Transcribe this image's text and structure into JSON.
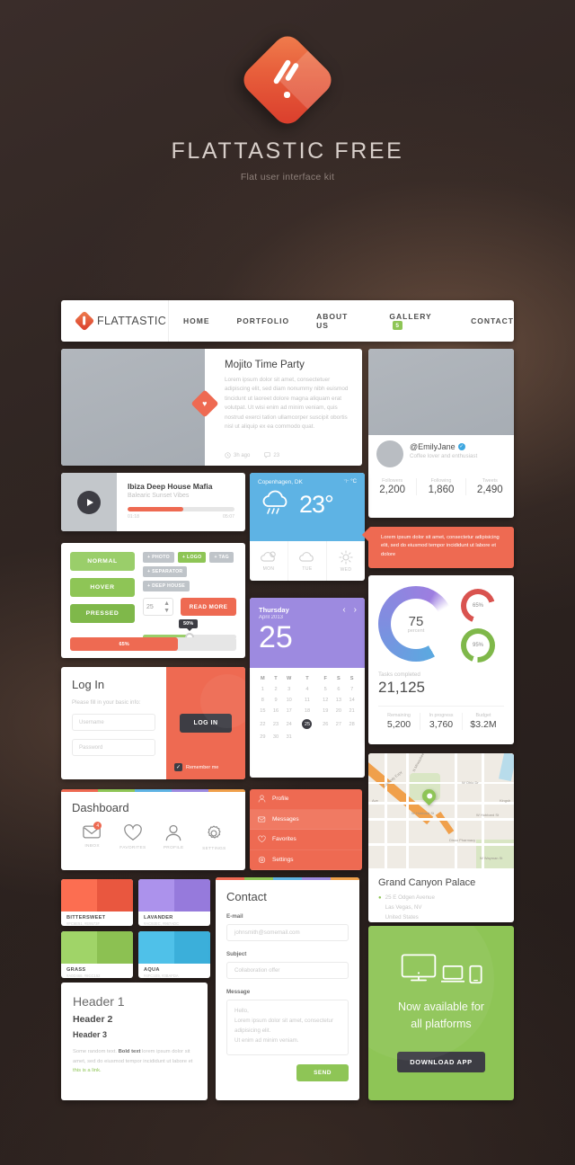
{
  "hero": {
    "title": "FLATTASTIC FREE",
    "subtitle": "Flat user interface kit",
    "logo_icon": "flattastic-diamond-logo"
  },
  "nav": {
    "brand": "FLATTASTIC",
    "links": [
      {
        "label": "HOME",
        "badge": null
      },
      {
        "label": "PORTFOLIO",
        "badge": null
      },
      {
        "label": "ABOUT US",
        "badge": null
      },
      {
        "label": "GALLERY",
        "badge": "5"
      },
      {
        "label": "CONTACT",
        "badge": null
      }
    ]
  },
  "article": {
    "title": "Mojito Time Party",
    "body": "Lorem ipsum dolor sit amet, consectetuer adipiscing elit, sed diam nonummy nibh euismod tincidunt ut laoreet dolore magna aliquam erat volutpat. Ut wisi enim ad minim veniam, quis nostrud exerci tation ullamcorper suscipit obortis nisl ut aliquip ex ea commodo quat.",
    "time": "3h ago",
    "comments": "23",
    "favorite_icon": "heart-icon",
    "clock_icon": "clock-icon",
    "comment_icon": "comment-bubble-icon"
  },
  "twitter": {
    "handle": "@EmilyJane",
    "verified_icon": "verified-check-icon",
    "bio": "Coffee lover and enthusiast",
    "stats": [
      {
        "label": "Followers",
        "value": "2,200"
      },
      {
        "label": "Following",
        "value": "1,860"
      },
      {
        "label": "Tweets",
        "value": "2,490"
      }
    ]
  },
  "music": {
    "title": "Ibiza Deep House Mafia",
    "subtitle": "Balearic Sunset Vibes",
    "elapsed": "01:18",
    "total": "05:07",
    "play_icon": "play-icon",
    "progress_percent": 52
  },
  "weather": {
    "city": "Copenhagen, DK",
    "unit_f": "°F",
    "unit_c": "°C",
    "temperature": "23°",
    "current_icon": "rain-cloud-icon",
    "forecast": [
      {
        "day": "MON",
        "icon": "partly-cloudy-icon"
      },
      {
        "day": "TUE",
        "icon": "cloud-icon"
      },
      {
        "day": "WED",
        "icon": "sun-icon"
      }
    ]
  },
  "alert": {
    "text": "Lorem ipsum dolor sit amet, consectetur adipisicing elit, sed do eiusmod tempor incididunt ut labore et dolore",
    "color": "#ee6a52"
  },
  "buttons_panel": {
    "states": [
      "NORMAL",
      "HOVER",
      "PRESSED"
    ],
    "tags": [
      {
        "label": "+ PHOTO",
        "active": false
      },
      {
        "label": "+ LOGO",
        "active": true
      },
      {
        "label": "+ TAG",
        "active": false
      },
      {
        "label": "+ SEPARATOR",
        "active": false
      },
      {
        "label": "+ DEEP HOUSE",
        "active": false
      }
    ],
    "spinner_value": "25",
    "read_more_label": "READ MORE",
    "slider_tooltip": "50%",
    "progress_label": "65%"
  },
  "calendar": {
    "weekday": "Thursday",
    "month_year": "April 2013",
    "day_number": "25",
    "prev_icon": "chevron-left-icon",
    "next_icon": "chevron-right-icon",
    "day_headers": [
      "M",
      "T",
      "W",
      "T",
      "F",
      "S",
      "S"
    ],
    "weeks": [
      [
        "1",
        "2",
        "3",
        "4",
        "5",
        "6",
        "7"
      ],
      [
        "8",
        "9",
        "10",
        "11",
        "12",
        "13",
        "14"
      ],
      [
        "15",
        "16",
        "17",
        "18",
        "19",
        "20",
        "21"
      ],
      [
        "22",
        "23",
        "24",
        "25",
        "26",
        "27",
        "28"
      ],
      [
        "29",
        "30",
        "31",
        "",
        "",
        "",
        ""
      ]
    ],
    "today": "25"
  },
  "stats": {
    "donut_value": "75",
    "donut_label": "percent",
    "mini": [
      {
        "value": "65%",
        "color": "#d9534f"
      },
      {
        "value": "95%",
        "color": "#7fb84a"
      }
    ],
    "tasks_label": "Tasks completed",
    "tasks_value": "21,125",
    "cells": [
      {
        "label": "Remaining",
        "value": "5,200"
      },
      {
        "label": "In progress",
        "value": "3,760"
      },
      {
        "label": "Budget",
        "value": "$3.2M"
      }
    ]
  },
  "login": {
    "title": "Log In",
    "subtitle": "Please fill in your basic info:",
    "username_placeholder": "Username",
    "password_placeholder": "Password",
    "button_label": "LOG IN",
    "remember_label": "Remember me",
    "check_icon": "checkmark-icon"
  },
  "dashboard": {
    "title": "Dashboard",
    "items": [
      {
        "label": "INBOX",
        "icon": "envelope-icon",
        "badge": "4"
      },
      {
        "label": "FAVORITES",
        "icon": "heart-icon",
        "badge": null
      },
      {
        "label": "PROFILE",
        "icon": "user-icon",
        "badge": null
      },
      {
        "label": "SETTINGS",
        "icon": "gear-icon",
        "badge": null
      }
    ]
  },
  "menu": {
    "items": [
      {
        "label": "Profile",
        "icon": "user-icon",
        "active": false
      },
      {
        "label": "Messages",
        "icon": "envelope-icon",
        "active": true
      },
      {
        "label": "Favorites",
        "icon": "heart-icon",
        "active": false
      },
      {
        "label": "Settings",
        "icon": "gear-icon",
        "active": false
      }
    ]
  },
  "map": {
    "title": "Grand Canyon Palace",
    "address_line1": "25 E Odgen Avenue",
    "address_line2": "Las Vegas, NV",
    "address_line3": "United States",
    "pin_icon": "map-pin-icon",
    "street_labels": [
      "N Milwaukee Ave",
      "Kennedy Expy",
      "W Ohio Dr",
      "W Hubbard St",
      "W Hubbard St",
      "Disco Pharmacy",
      "W Wayman St",
      "Ave",
      "Kingsb"
    ]
  },
  "swatches": [
    {
      "name": "BITTERSWEET",
      "hex": "#FC6E51, #E9573F",
      "c1": "#fc6e51",
      "c2": "#e9573f"
    },
    {
      "name": "LAVANDER",
      "hex": "#AC92EC, #967ADC",
      "c1": "#ac92ec",
      "c2": "#967adc"
    },
    {
      "name": "GRASS",
      "hex": "#A0D468, #8CC152",
      "c1": "#a0d468",
      "c2": "#8cc152"
    },
    {
      "name": "AQUA",
      "hex": "#4FC1E9, #3BAFDA",
      "c1": "#4fc1e9",
      "c2": "#3bafda"
    }
  ],
  "contact": {
    "title": "Contact",
    "email_label": "E-mail",
    "email_placeholder": "johnsmith@somemail.com",
    "subject_label": "Subject",
    "subject_placeholder": "Collaboration offer",
    "message_label": "Message",
    "message_placeholder": "Hello,\nLorem ipsum dolor sit amet, consectetur adipisicing elit.\nUt enim ad minim veniam.",
    "send_label": "SEND"
  },
  "typography": {
    "h1": "Header 1",
    "h2": "Header 2",
    "h3": "Header 3",
    "para_start": "Some random text. ",
    "para_bold": "Bold text",
    "para_mid": " lorem ipsum dolor sit amet, sed do eiusmod tempor incididunt ut labore et ",
    "para_link": "this is a link."
  },
  "download": {
    "line1": "Now available for",
    "line2": "all platforms",
    "button_label": "DOWNLOAD APP",
    "icons": [
      "desktop-monitor-icon",
      "laptop-icon",
      "tablet-icon"
    ]
  },
  "strip_colors": [
    "#ee6a52",
    "#8ec556",
    "#5eb3e4",
    "#9d8ae0",
    "#f0a04b"
  ]
}
